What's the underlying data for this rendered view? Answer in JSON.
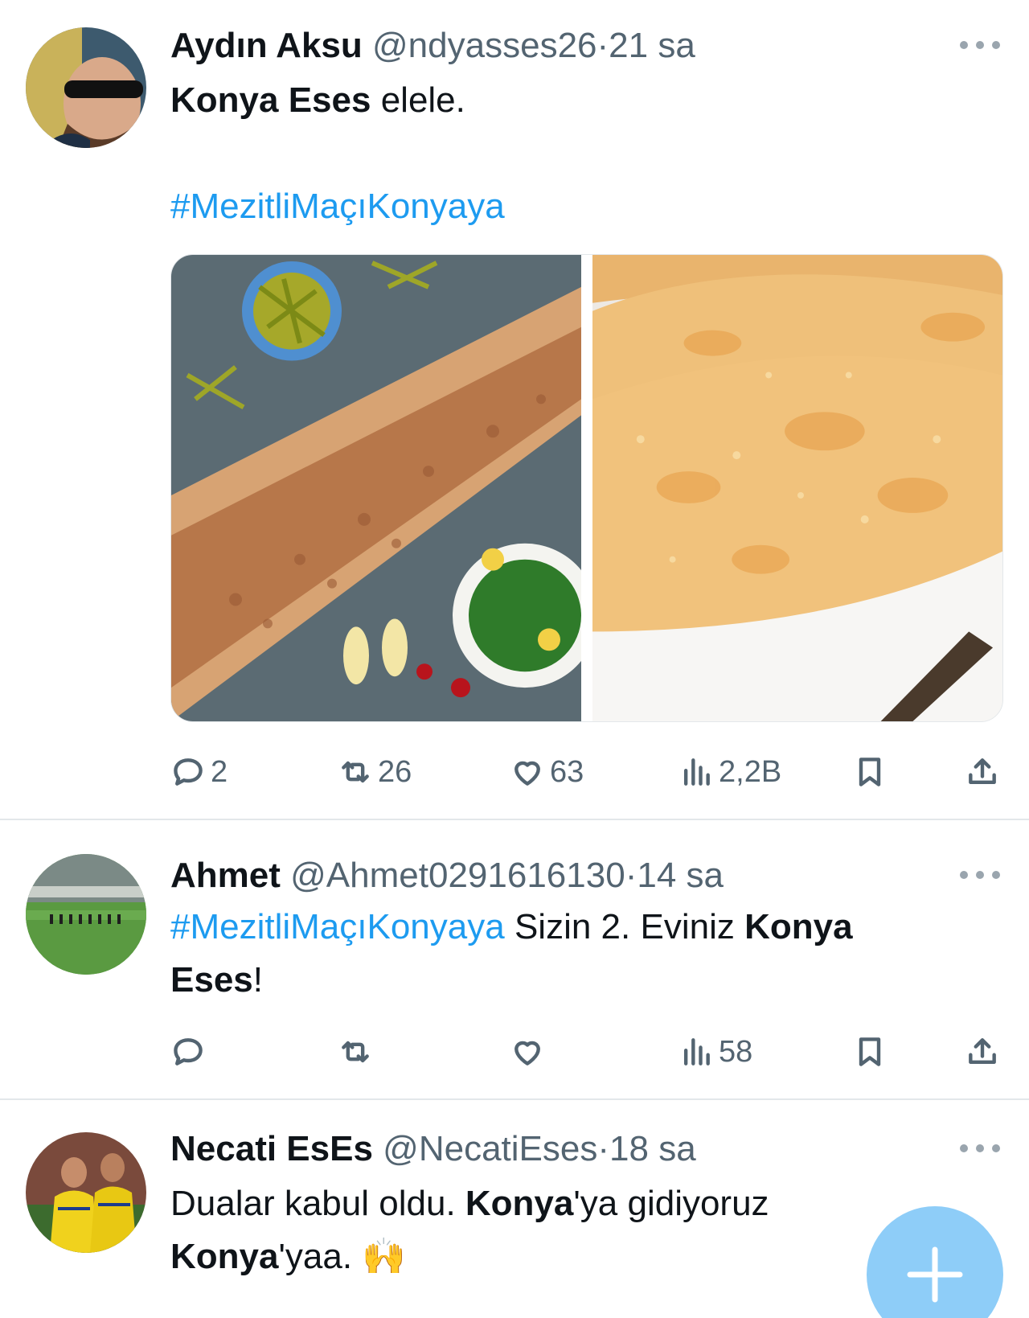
{
  "tweets": [
    {
      "author": "Aydın Aksu",
      "handle": "@ndyasses26",
      "time": "21 sa",
      "text_bold": "Konya Eses",
      "text_rest": " elele.",
      "hashtag": "#MezitliMaçıKonyaya",
      "stats": {
        "replies": "2",
        "retweets": "26",
        "likes": "63",
        "views": "2,2B"
      }
    },
    {
      "author": "Ahmet",
      "handle": "@Ahmet0291616130",
      "time": "14 sa",
      "hashtag": "#MezitliMaçıKonyaya",
      "text_mid": " Sizin 2. Eviniz ",
      "text_bold1": "Konya",
      "text_bold2": "Eses",
      "text_end": "!",
      "stats": {
        "views": "58"
      }
    },
    {
      "author": "Necati EsEs",
      "handle": "@NecatiEses",
      "time": "18 sa",
      "text_a": "Dualar kabul oldu. ",
      "text_bold1": "Konya",
      "text_b": "'ya gidiyoruz",
      "text_bold2": "Konya",
      "text_c": "'yaa. ",
      "emoji": "🙌"
    }
  ],
  "separator": "·",
  "icons": [
    "reply-icon",
    "retweet-icon",
    "like-icon",
    "views-icon",
    "bookmark-icon",
    "share-icon",
    "more-icon",
    "compose-plus-icon"
  ],
  "colors": {
    "link": "#1d9bf0",
    "secondary": "#536471",
    "fab": "#8ecdf8"
  }
}
